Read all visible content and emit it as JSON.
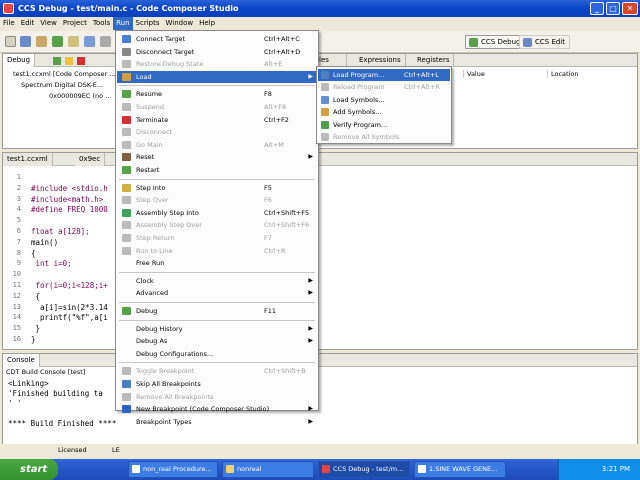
{
  "window": {
    "title": "CCS Debug - test/main.c - Code Composer Studio",
    "min": "_",
    "max": "□",
    "close": "✕"
  },
  "menubar": [
    "File",
    "Edit",
    "View",
    "Project",
    "Tools",
    "Run",
    "Scripts",
    "Window",
    "Help"
  ],
  "perspectives": {
    "debug": "CCS Debug",
    "edit": "CCS Edit"
  },
  "debug_view": {
    "tab": "Debug",
    "tree": [
      "test1.ccxml [Code Composer ...",
      "Spectrum Digital DSK-E...",
      "0x000009EC (no ..."
    ]
  },
  "variables_view": {
    "tabs": [
      "Variables",
      "Expressions",
      "Registers"
    ],
    "tab_fragment": "les",
    "columns": [
      "Value",
      "Location"
    ]
  },
  "editor": {
    "tabs": [
      "test1.ccxml",
      "0x9ec"
    ],
    "lines": [
      {
        "n": "1",
        "t": ""
      },
      {
        "n": "2",
        "t": "#include <stdio.h"
      },
      {
        "n": "3",
        "t": "#include<math.h>"
      },
      {
        "n": "4",
        "t": "#define FREQ 1000"
      },
      {
        "n": "5",
        "t": ""
      },
      {
        "n": "6",
        "t": "float a[128];"
      },
      {
        "n": "7",
        "t": "main()"
      },
      {
        "n": "8",
        "t": "{"
      },
      {
        "n": "9",
        "t": " int i=0;"
      },
      {
        "n": "10",
        "t": ""
      },
      {
        "n": "11",
        "t": " for(i=0;i<128;i+"
      },
      {
        "n": "12",
        "t": " {"
      },
      {
        "n": "13",
        "t": "  a[i]=sin(2*3.14"
      },
      {
        "n": "14",
        "t": "  printf(\"%f\",a[i"
      },
      {
        "n": "15",
        "t": " }"
      },
      {
        "n": "16",
        "t": "}"
      }
    ]
  },
  "console": {
    "tab": "Console",
    "header": "CDT Build Console [test]",
    "lines": [
      "<Linking>",
      "'Finished building ta",
      "' '",
      "",
      "**** Build Finished ****"
    ]
  },
  "statusbar": {
    "licensed": "Licensed",
    "mode": "LE"
  },
  "run_menu": {
    "items": [
      {
        "label": "Connect Target",
        "acc": "Ctrl+Alt+C",
        "disabled": false
      },
      {
        "label": "Disconnect Target",
        "acc": "Ctrl+Alt+D",
        "disabled": false
      },
      {
        "label": "Restore Debug State",
        "acc": "Alt+E",
        "disabled": true
      },
      {
        "label": "Load",
        "acc": "",
        "disabled": false,
        "submenu": true,
        "highlight": true
      },
      {
        "label": "Resume",
        "acc": "F8",
        "disabled": false
      },
      {
        "label": "Suspend",
        "acc": "Alt+F8",
        "disabled": true
      },
      {
        "label": "Terminate",
        "acc": "Ctrl+F2",
        "disabled": false
      },
      {
        "label": "Disconnect",
        "acc": "",
        "disabled": true
      },
      {
        "label": "Go Main",
        "acc": "Alt+M",
        "disabled": true
      },
      {
        "label": "Reset",
        "acc": "",
        "disabled": false,
        "submenu": true
      },
      {
        "label": "Restart",
        "acc": "",
        "disabled": false
      },
      {
        "label": "Step Into",
        "acc": "F5",
        "disabled": false
      },
      {
        "label": "Step Over",
        "acc": "F6",
        "disabled": true
      },
      {
        "label": "Assembly Step Into",
        "acc": "Ctrl+Shift+F5",
        "disabled": false
      },
      {
        "label": "Assembly Step Over",
        "acc": "Ctrl+Shift+F6",
        "disabled": true
      },
      {
        "label": "Step Return",
        "acc": "F7",
        "disabled": true
      },
      {
        "label": "Run to Line",
        "acc": "Ctrl+R",
        "disabled": true
      },
      {
        "label": "Free Run",
        "acc": "",
        "disabled": false
      },
      {
        "label": "Clock",
        "acc": "",
        "disabled": false,
        "submenu": true
      },
      {
        "label": "Advanced",
        "acc": "",
        "disabled": false,
        "submenu": true
      },
      {
        "label": "Debug",
        "acc": "F11",
        "disabled": false
      },
      {
        "label": "Debug History",
        "acc": "",
        "disabled": false,
        "submenu": true
      },
      {
        "label": "Debug As",
        "acc": "",
        "disabled": false,
        "submenu": true
      },
      {
        "label": "Debug Configurations...",
        "acc": "",
        "disabled": false
      },
      {
        "label": "Toggle Breakpoint",
        "acc": "Ctrl+Shift+B",
        "disabled": true
      },
      {
        "label": "Skip All Breakpoints",
        "acc": "",
        "disabled": false
      },
      {
        "label": "Remove All Breakpoints",
        "acc": "",
        "disabled": true
      },
      {
        "label": "New Breakpoint (Code Composer Studio)",
        "acc": "",
        "disabled": false,
        "submenu": true
      },
      {
        "label": "Breakpoint Types",
        "acc": "",
        "disabled": false,
        "submenu": true
      }
    ]
  },
  "load_submenu": {
    "items": [
      {
        "label": "Load Program...",
        "acc": "Ctrl+Alt+L",
        "disabled": false,
        "highlight": true
      },
      {
        "label": "Reload Program",
        "acc": "Ctrl+Alt+R",
        "disabled": true
      },
      {
        "label": "Load Symbols...",
        "acc": "",
        "disabled": false
      },
      {
        "label": "Add Symbols...",
        "acc": "",
        "disabled": false
      },
      {
        "label": "Verify Program...",
        "acc": "",
        "disabled": false
      },
      {
        "label": "Remove All Symbols",
        "acc": "",
        "disabled": true
      }
    ]
  },
  "taskbar": {
    "start": "start",
    "tasks": [
      "non_real Procedure...",
      "nonreal",
      "CCS Debug - test/m...",
      "1.SINE WAVE GENE..."
    ],
    "clock": "3:21 PM"
  },
  "colors": {
    "accent": "#316ac5",
    "titlebar": "#0b47c8",
    "keyword": "#7f0055"
  }
}
